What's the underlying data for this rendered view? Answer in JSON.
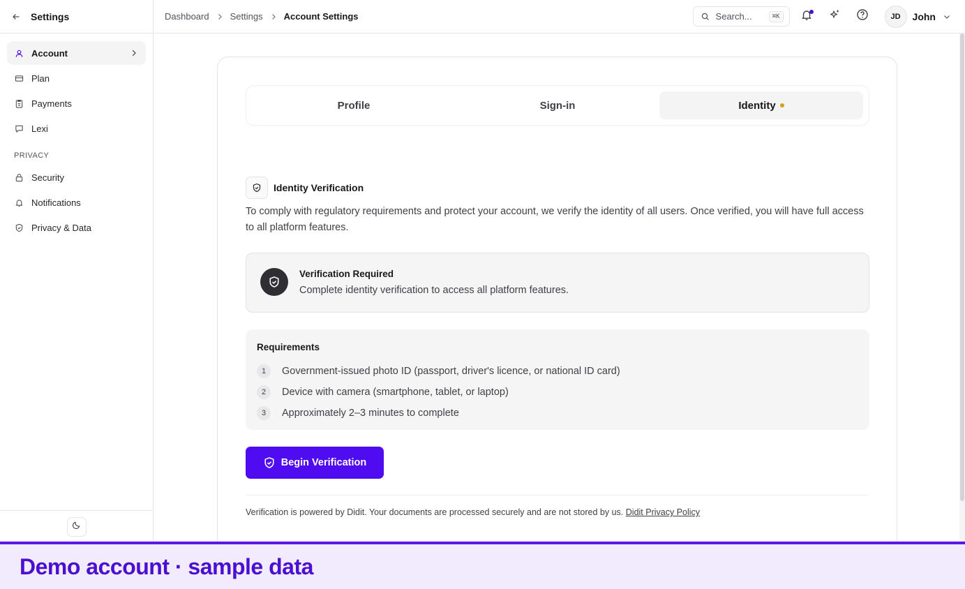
{
  "sidebar": {
    "title": "Settings",
    "items": [
      {
        "label": "Account",
        "icon": "user-icon"
      },
      {
        "label": "Plan",
        "icon": "card-icon"
      },
      {
        "label": "Payments",
        "icon": "clipboard-icon"
      },
      {
        "label": "Lexi",
        "icon": "chat-icon"
      }
    ],
    "section_label": "PRIVACY",
    "privacy_items": [
      {
        "label": "Security",
        "icon": "lock-icon"
      },
      {
        "label": "Notifications",
        "icon": "bell-icon"
      },
      {
        "label": "Privacy & Data",
        "icon": "shield-icon"
      }
    ]
  },
  "breadcrumb": {
    "items": [
      "Dashboard",
      "Settings"
    ],
    "current": "Account Settings"
  },
  "topbar": {
    "search_placeholder": "Search...",
    "search_shortcut": "⌘K",
    "user_initials": "JD",
    "user_name": "John"
  },
  "tabs": [
    {
      "label": "Profile"
    },
    {
      "label": "Sign-in"
    },
    {
      "label": "Identity"
    }
  ],
  "identity": {
    "title": "Identity Verification",
    "description": "To comply with regulatory requirements and protect your account, we verify the identity of all users. Once verified, you will have full access to all platform features.",
    "status_title": "Verification Required",
    "status_desc": "Complete identity verification to access all platform features.",
    "requirements_title": "Requirements",
    "requirements": [
      {
        "num": "1",
        "text": "Government-issued photo ID (passport, driver's licence, or national ID card)"
      },
      {
        "num": "2",
        "text": "Device with camera (smartphone, tablet, or laptop)"
      },
      {
        "num": "3",
        "text": "Approximately 2–3 minutes to complete"
      }
    ],
    "button_label": "Begin Verification",
    "footer_text": "Verification is powered by Didit. Your documents are processed securely and are not stored by us.",
    "footer_link": "Didit Privacy Policy"
  },
  "banner": {
    "text": "Demo account · sample data"
  },
  "colors": {
    "accent": "#4f0cf0",
    "pending_dot": "#d4a017",
    "banner_bg": "#f1ebfd"
  }
}
